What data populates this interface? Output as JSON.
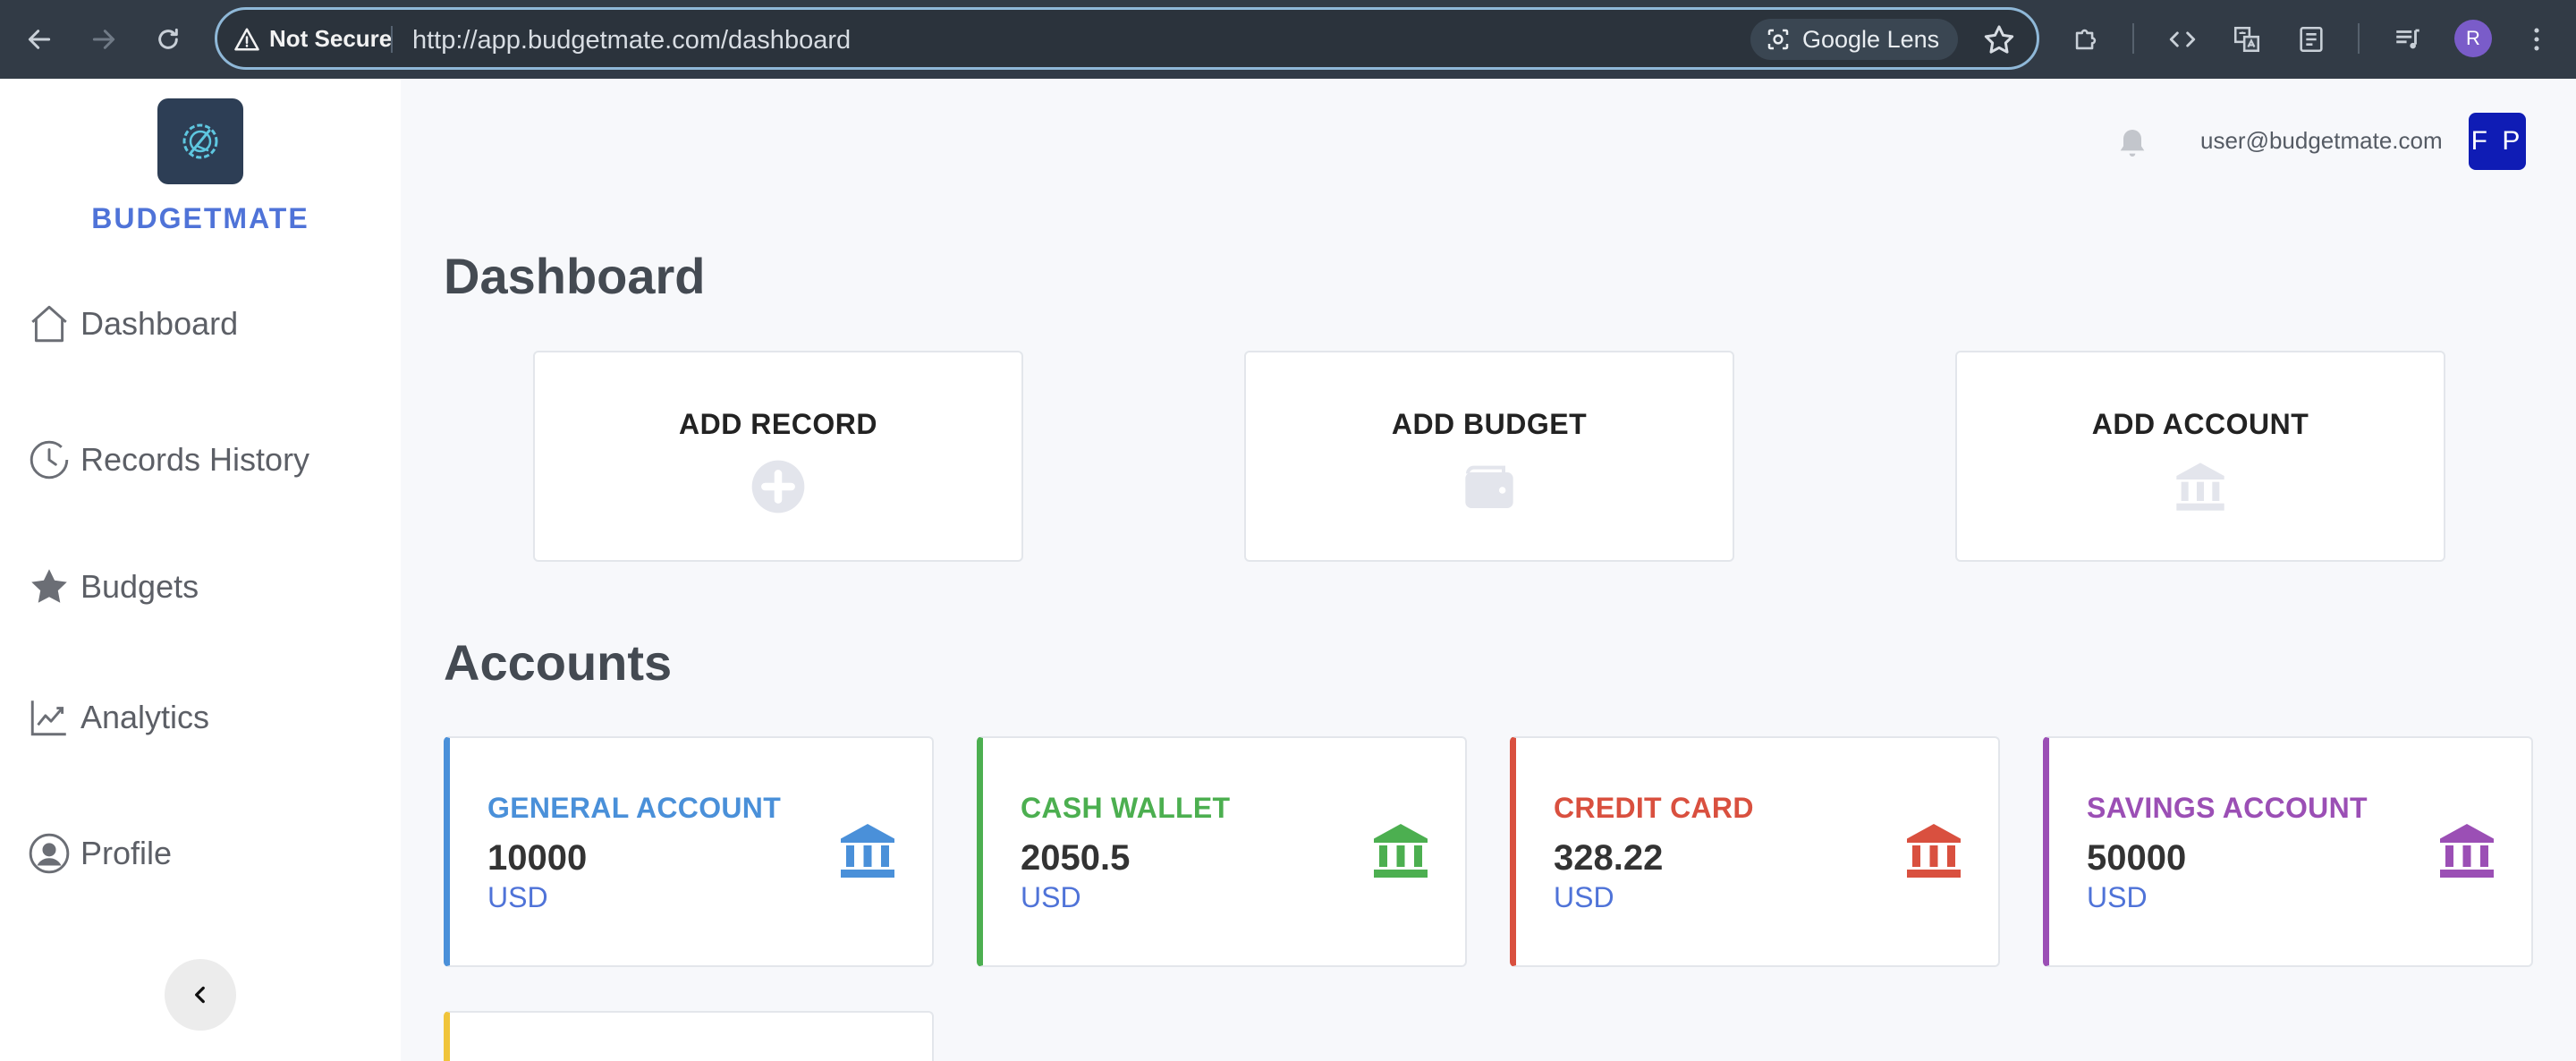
{
  "browser": {
    "security_label": "Not Secure",
    "url": "http://app.budgetmate.com/dashboard",
    "lens_label": "Google Lens",
    "profile_initial": "R"
  },
  "sidebar": {
    "brand": "BUDGETMATE",
    "items": [
      {
        "label": "Dashboard",
        "icon": "home-icon"
      },
      {
        "label": "Records History",
        "icon": "clock-icon"
      },
      {
        "label": "Budgets",
        "icon": "star-icon"
      },
      {
        "label": "Analytics",
        "icon": "chart-line-icon"
      },
      {
        "label": "Profile",
        "icon": "user-circle-icon"
      }
    ]
  },
  "header": {
    "user_email": "user@budgetmate.com",
    "avatar_initials": "F P"
  },
  "dashboard": {
    "title": "Dashboard",
    "actions": [
      {
        "label": "ADD RECORD",
        "icon": "plus-circle-icon"
      },
      {
        "label": "ADD BUDGET",
        "icon": "wallet-icon"
      },
      {
        "label": "ADD ACCOUNT",
        "icon": "bank-icon"
      }
    ]
  },
  "accounts": {
    "title": "Accounts",
    "items": [
      {
        "name": "GENERAL ACCOUNT",
        "balance": "10000",
        "currency": "USD",
        "color": "#4a90d9"
      },
      {
        "name": "CASH WALLET",
        "balance": "2050.5",
        "currency": "USD",
        "color": "#4caf50"
      },
      {
        "name": "CREDIT CARD",
        "balance": "328.22",
        "currency": "USD",
        "color": "#d9503f"
      },
      {
        "name": "SAVINGS ACCOUNT",
        "balance": "50000",
        "currency": "USD",
        "color": "#9b4fb5"
      }
    ],
    "partial_card_color": "#f0c43a"
  }
}
